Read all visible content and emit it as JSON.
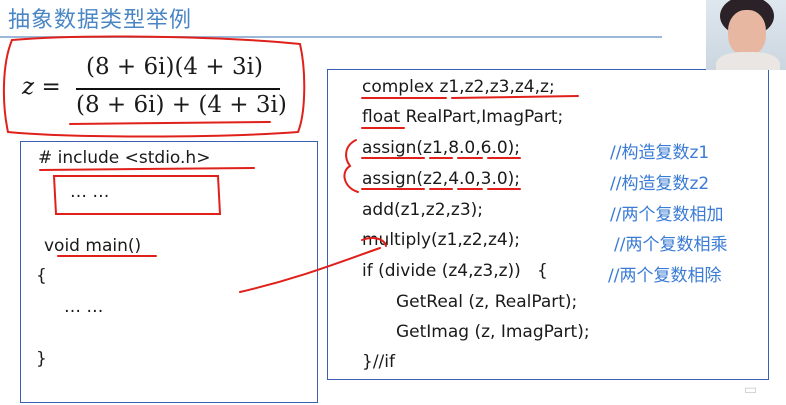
{
  "slide": {
    "title": "抽象数据类型举例"
  },
  "formula": {
    "lhs": "z",
    "equals": "=",
    "numerator": "(8 + 6i)(4 + 3i)",
    "denominator": "(8 + 6i) + (4 + 3i)"
  },
  "left_code": [
    "# include <stdio.h>",
    "… …",
    "void main()",
    "{",
    "… …",
    "}"
  ],
  "right_code": [
    {
      "code": "complex z1,z2,z3,z4,z;",
      "comment": ""
    },
    {
      "code": "float RealPart,ImagPart;",
      "comment": ""
    },
    {
      "code": "assign(z1,8.0,6.0);",
      "comment": "//构造复数z1"
    },
    {
      "code": "assign(z2,4.0,3.0);",
      "comment": "//构造复数z2"
    },
    {
      "code": "add(z1,z2,z3);",
      "comment": "//两个复数相加"
    },
    {
      "code": "multiply(z1,z2,z4);",
      "comment": "//两个复数相乘"
    },
    {
      "code": "if (divide (z4,z3,z))   {",
      "comment": "//两个复数相除"
    },
    {
      "code": "GetReal (z, RealPart);",
      "comment": ""
    },
    {
      "code": "GetImag (z, ImagPart);",
      "comment": ""
    },
    {
      "code": "}//if",
      "comment": ""
    }
  ],
  "colors": {
    "title": "#4a86c5",
    "box_border": "#3b5fb0",
    "comment": "#3a7bd5",
    "annotation": "#e0201b"
  },
  "icons": {
    "logo": "watermark-logo-icon"
  }
}
